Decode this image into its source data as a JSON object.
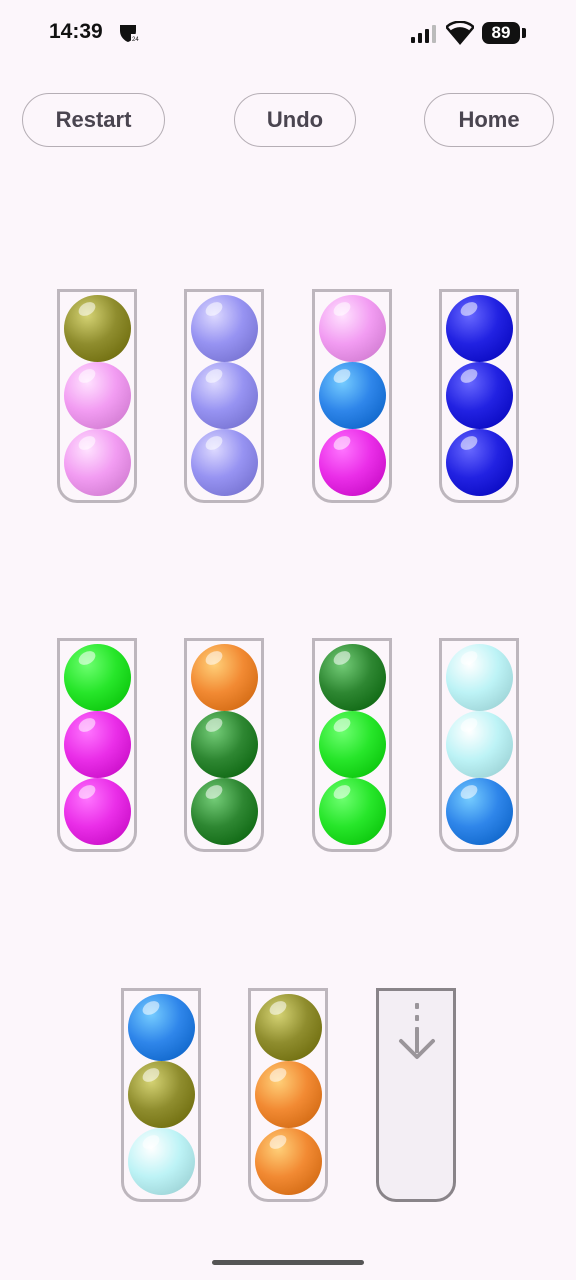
{
  "status": {
    "time": "14:39",
    "battery": "89",
    "notification_icon": "shield-notification-icon",
    "signal_icon": "cellular-signal-icon",
    "wifi_icon": "wifi-icon"
  },
  "toolbar": {
    "restart_label": "Restart",
    "undo_label": "Undo",
    "home_label": "Home"
  },
  "colors": {
    "olive": "#8f8d2e",
    "pink": "#f29cf2",
    "lavender": "#9793f2",
    "blue": "#2f86ea",
    "magenta": "#ea2ee8",
    "navy": "#2222e2",
    "green": "#27e62a",
    "orange": "#f28a33",
    "darkgreen": "#2e8732",
    "lightcyan": "#bdf3f6"
  },
  "board": {
    "tubes": [
      {
        "balls": [
          "olive",
          "pink",
          "pink"
        ]
      },
      {
        "balls": [
          "lavender",
          "lavender",
          "lavender"
        ]
      },
      {
        "balls": [
          "pink",
          "blue",
          "magenta"
        ]
      },
      {
        "balls": [
          "navy",
          "navy",
          "navy"
        ]
      },
      {
        "balls": [
          "green",
          "magenta",
          "magenta"
        ]
      },
      {
        "balls": [
          "orange",
          "darkgreen",
          "darkgreen"
        ]
      },
      {
        "balls": [
          "darkgreen",
          "green",
          "green"
        ]
      },
      {
        "balls": [
          "lightcyan",
          "lightcyan",
          "blue"
        ]
      },
      {
        "balls": [
          "blue",
          "olive",
          "lightcyan"
        ]
      },
      {
        "balls": [
          "olive",
          "orange",
          "orange"
        ]
      },
      {
        "balls": [],
        "target_icon": "arrow-down-icon"
      }
    ]
  }
}
